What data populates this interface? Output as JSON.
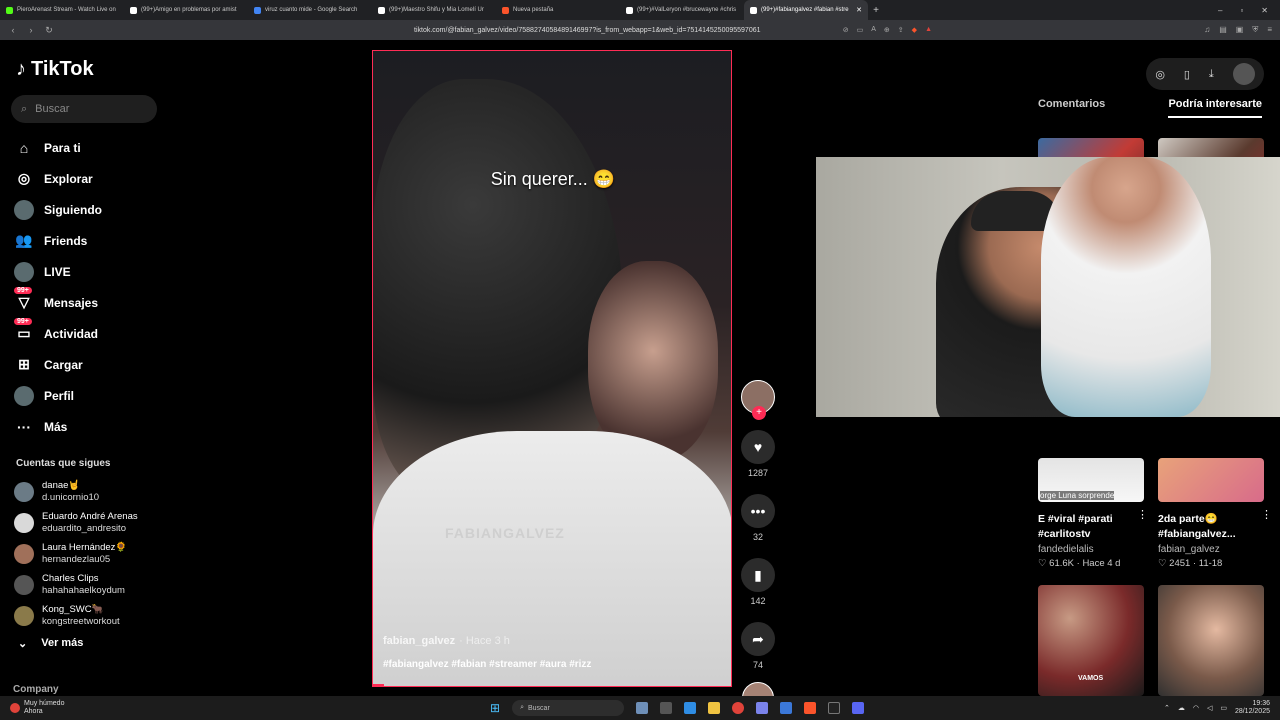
{
  "browser": {
    "tabs": [
      {
        "title": "PieroArenast Stream - Watch Live on",
        "color": "#53fc18"
      },
      {
        "title": "(99+)Amigo en problemas por amist",
        "color": "#ffffff"
      },
      {
        "title": "viruz cuanto mide - Google Search",
        "color": "#4285f4"
      },
      {
        "title": "(99+)Maestro Shifu y Mia Lomelí Ur",
        "color": "#ffffff"
      },
      {
        "title": "Nueva pestaña",
        "color": "#fb542b"
      },
      {
        "title": "(99+)#ValLeryon #brucewayne #chris",
        "color": "#ffffff"
      },
      {
        "title": "(99+)#fabiangalvez #fabian #stre",
        "color": "#ffffff",
        "active": true
      }
    ],
    "url": "tiktok.com/@fabian_galvez/video/7588274058489146997?is_from_webapp=1&web_id=7514145250095597061"
  },
  "sidebar": {
    "logo": "TikTok",
    "search_placeholder": "Buscar",
    "nav": [
      {
        "label": "Para ti",
        "icon": "home-icon",
        "glyph": "⌂"
      },
      {
        "label": "Explorar",
        "icon": "compass-icon",
        "glyph": "◎"
      },
      {
        "label": "Siguiendo",
        "icon": "following-icon",
        "glyph": "●"
      },
      {
        "label": "Friends",
        "icon": "friends-icon",
        "glyph": "👥"
      },
      {
        "label": "LIVE",
        "icon": "live-icon",
        "glyph": "●"
      },
      {
        "label": "Mensajes",
        "icon": "messages-icon",
        "glyph": "▽",
        "badge": "99+"
      },
      {
        "label": "Actividad",
        "icon": "activity-icon",
        "glyph": "▭",
        "badge": "99+"
      },
      {
        "label": "Cargar",
        "icon": "upload-icon",
        "glyph": "⊞"
      },
      {
        "label": "Perfil",
        "icon": "profile-icon",
        "glyph": "●"
      },
      {
        "label": "Más",
        "icon": "more-icon",
        "glyph": "···"
      }
    ],
    "following_title": "Cuentas que sigues",
    "following": [
      {
        "name": "danae🤘",
        "handle": "d.unicornio10",
        "color": "#6b7b86"
      },
      {
        "name": "Eduardo André Arenas",
        "handle": "eduardito_andresito",
        "color": "#d9d9d9"
      },
      {
        "name": "Laura Hernández🌻",
        "handle": "hernandezlau05",
        "color": "#a0705a"
      },
      {
        "name": "Charles Clips",
        "handle": "hahahahaelkoydum",
        "color": "#555555"
      },
      {
        "name": "Kong_SWC🐂",
        "handle": "kongstreetworkout",
        "color": "#8a7a4a"
      }
    ],
    "ver_mas": "Ver más",
    "company": "Company"
  },
  "video": {
    "caption": "Sin querer... 😁",
    "watermark": "FABIANGALVEZ",
    "author": "fabian_galvez",
    "time": "· Hace 3 h",
    "tags": "#fabiangalvez #fabian #streamer #aura #rizz",
    "likes": "1287",
    "comments": "32",
    "saves": "142",
    "shares": "74",
    "progress": 0.03
  },
  "right_panel": {
    "tabs": [
      "Comentarios",
      "Podría interesarte"
    ],
    "active_tab": "Podría interesarte",
    "cards": [
      {
        "title": "E #viral #parati #carlitostv",
        "author": "fandedielalis",
        "likes": "61.6K",
        "age": "Hace 4 d",
        "overlay_text": "orge Luna sorprende"
      },
      {
        "title": "2da parte😁 #fabiangalvez...",
        "author": "fabian_galvez",
        "likes": "2451",
        "age": "11-18"
      }
    ],
    "bottom_card_text": "VAMOS"
  },
  "taskbar": {
    "weather_title": "Muy húmedo",
    "weather_sub": "Ahora",
    "search": "Buscar",
    "time": "19:36",
    "date": "28/12/2025"
  }
}
